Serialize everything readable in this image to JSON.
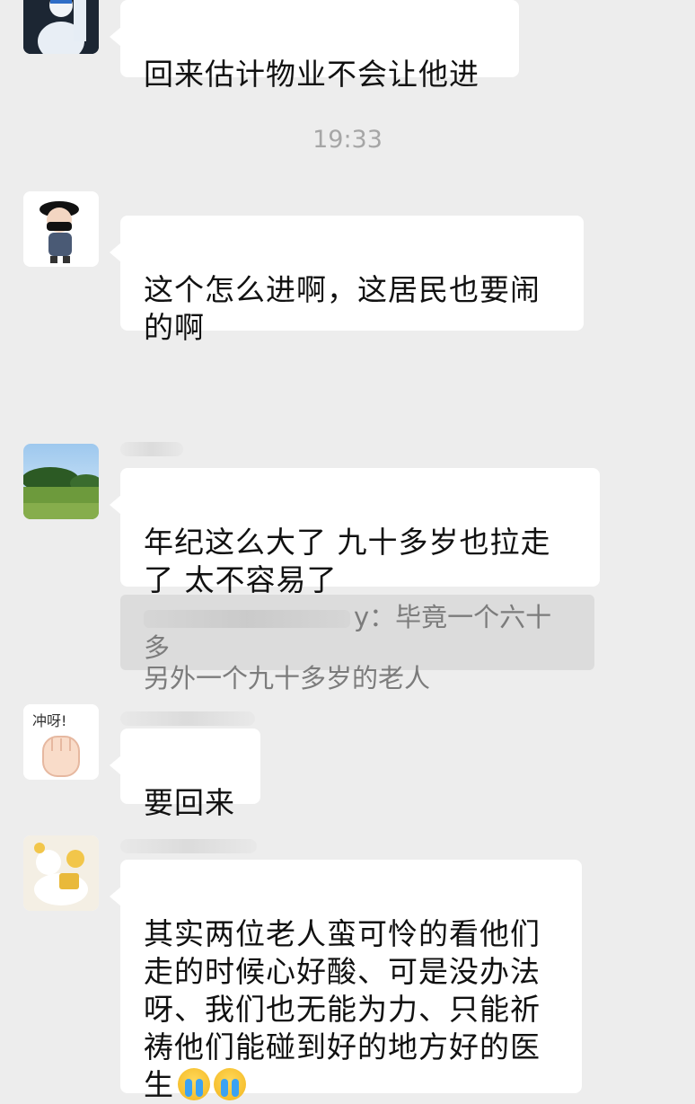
{
  "conversation": {
    "messages": [
      {
        "text": "回来估计物业不会让他进"
      },
      {
        "text": "这个怎么进啊，这居民也要闹\n的啊"
      },
      {
        "text": "年纪这么大了  九十多岁也拉走\n了 太不容易了"
      },
      {
        "text": "要回来"
      },
      {
        "text": "其实两位老人蛮可怜的看他们\n走的时候心好酸、可是没办法\n呀、我们也无能为力、只能祈\n祷他们能碰到好的地方好的医\n生"
      }
    ],
    "timestamp": "19:33",
    "quote": {
      "sender_suffix": "y：",
      "line1": "毕竟一个六十多",
      "line2": "另外一个九十多岁的老人"
    },
    "emoji": {
      "name": "crying-face-emoji",
      "count": 2
    },
    "sticker_text": "冲呀!"
  },
  "colors": {
    "background": "#ededed",
    "bubble": "#ffffff",
    "quote_bg": "#dcdcdc",
    "timestamp": "#a6a6a6"
  }
}
